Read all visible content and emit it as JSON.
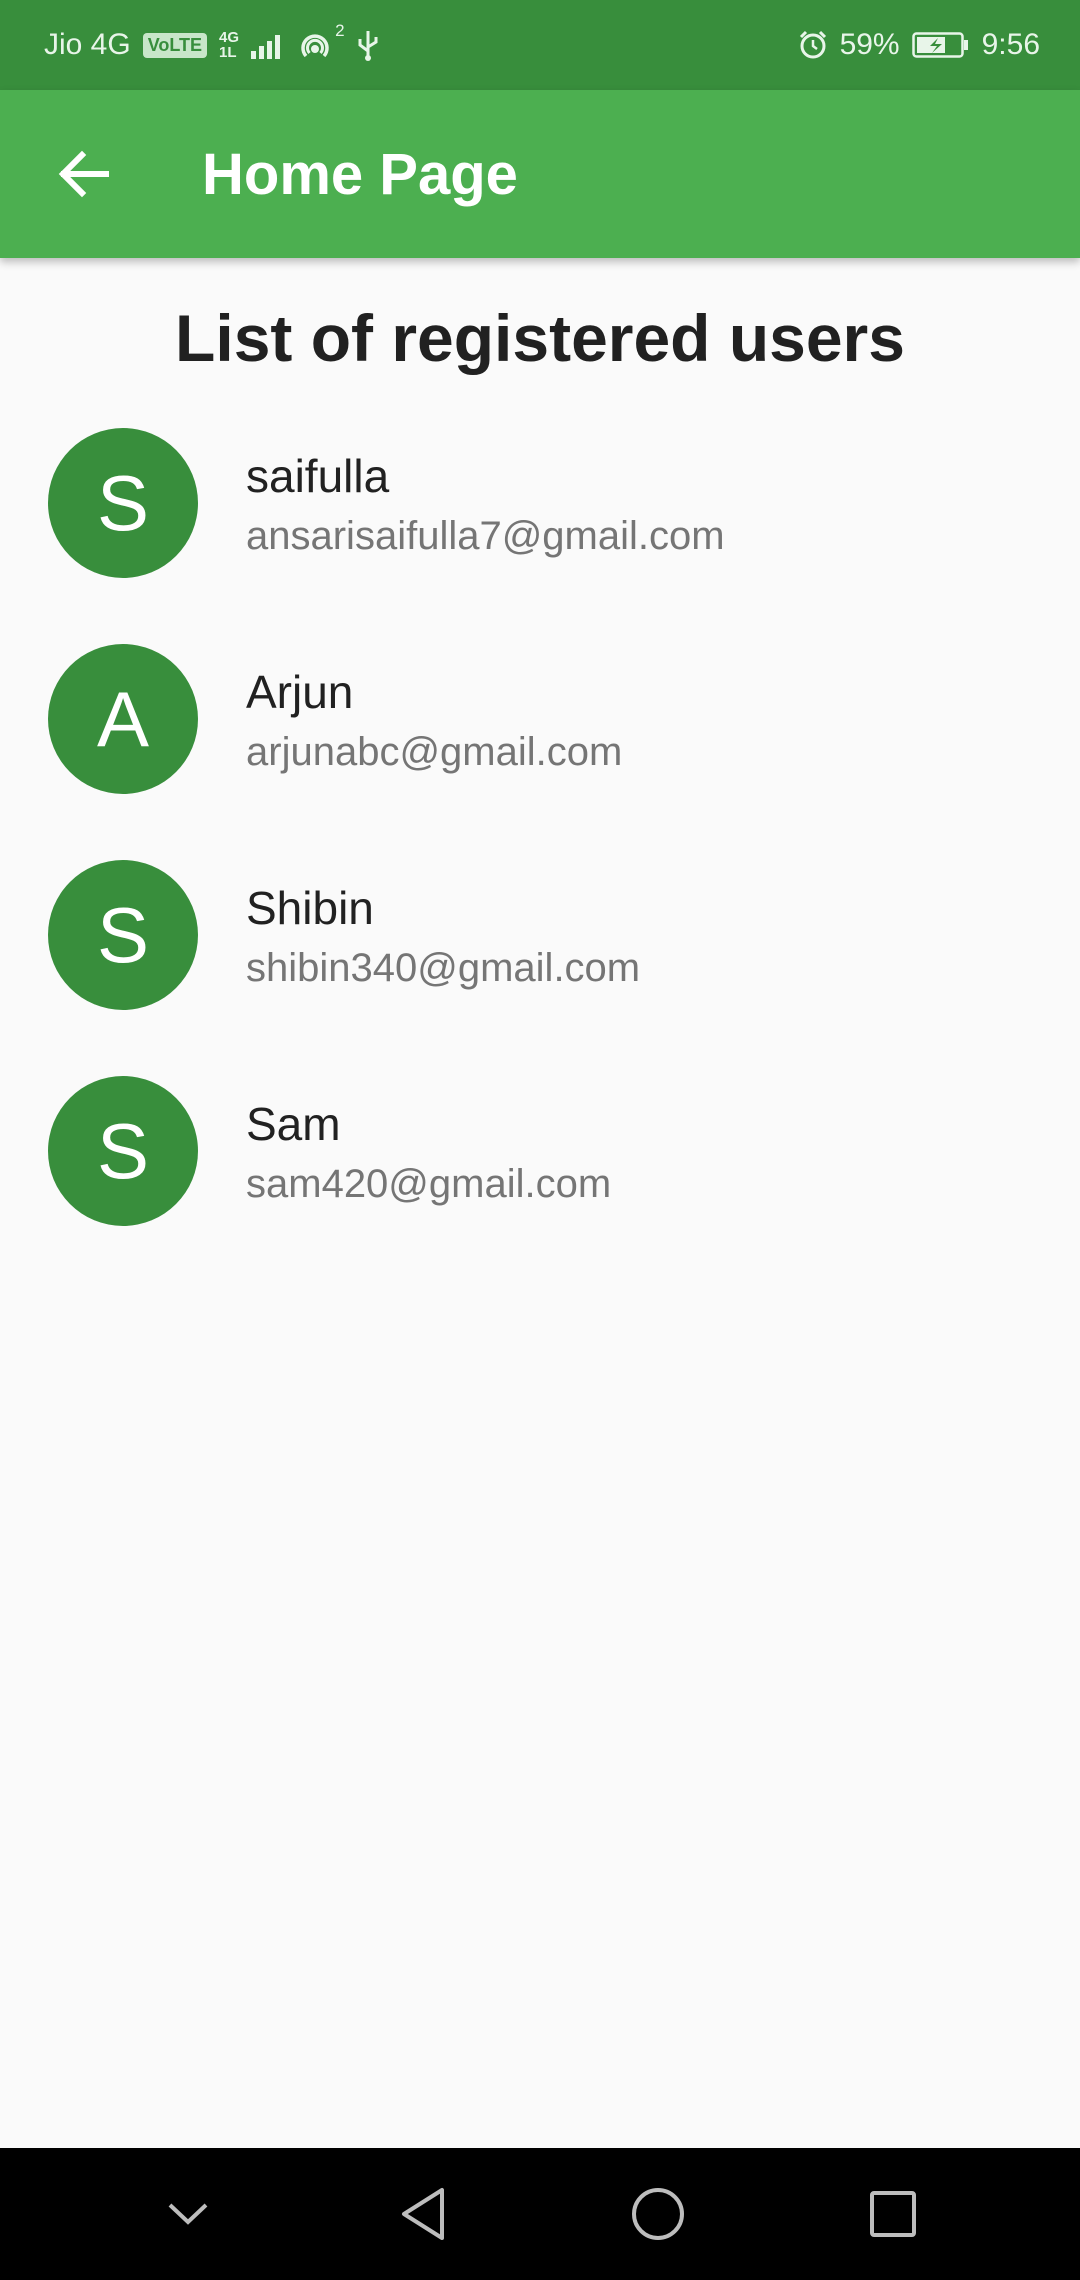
{
  "status_bar": {
    "carrier": "Jio 4G",
    "volte": "VoLTE",
    "net_top": "4G",
    "net_bottom": "1L",
    "hotspot_count": "2",
    "battery": "59%",
    "time": "9:56"
  },
  "app_bar": {
    "title": "Home Page",
    "back_icon": "arrow-back-icon"
  },
  "heading": "List of registered users",
  "users": [
    {
      "initial": "S",
      "name": "saifulla",
      "email": "ansarisaifulla7@gmail.com"
    },
    {
      "initial": "A",
      "name": "Arjun",
      "email": "arjunabc@gmail.com"
    },
    {
      "initial": "S",
      "name": "Shibin",
      "email": "shibin340@gmail.com"
    },
    {
      "initial": "S",
      "name": "Sam",
      "email": "sam420@gmail.com"
    }
  ],
  "nav_bar": {
    "icons": [
      "chevron-down-icon",
      "back-triangle-icon",
      "home-circle-icon",
      "recents-square-icon"
    ]
  },
  "colors": {
    "status_bar": "#388e3c",
    "app_bar": "#4caf50",
    "avatar": "#388e3c",
    "background": "#fafafa"
  }
}
